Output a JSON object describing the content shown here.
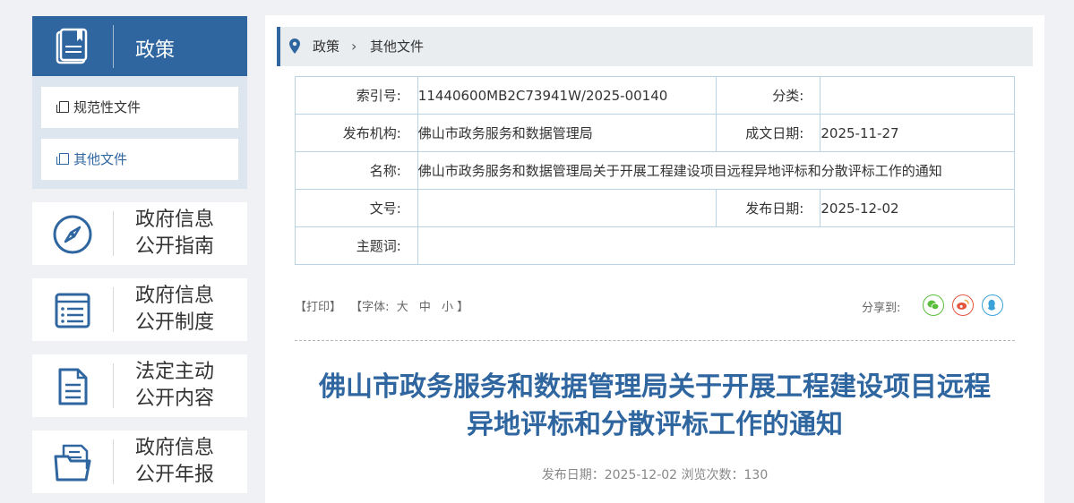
{
  "sidebar": {
    "policy_title": "政策",
    "sub_items": [
      {
        "label": "规范性文件"
      },
      {
        "label": "其他文件"
      }
    ],
    "cards": [
      {
        "line1": "政府信息",
        "line2": "公开指南",
        "icon": "compass-icon"
      },
      {
        "line1": "政府信息",
        "line2": "公开制度",
        "icon": "list-icon"
      },
      {
        "line1": "法定主动",
        "line2": "公开内容",
        "icon": "document-icon"
      },
      {
        "line1": "政府信息",
        "line2": "公开年报",
        "icon": "folder-icon"
      }
    ]
  },
  "breadcrumb": {
    "items": [
      "政策",
      "其他文件"
    ],
    "separator": "›"
  },
  "meta": {
    "index_label": "索引号:",
    "index_value": "11440600MB2C73941W/2025-00140",
    "category_label": "分类:",
    "category_value": "",
    "publisher_label": "发布机构:",
    "publisher_value": "佛山市政务服务和数据管理局",
    "written_date_label": "成文日期:",
    "written_date_value": "2025-11-27",
    "name_label": "名称:",
    "name_value": "佛山市政务服务和数据管理局关于开展工程建设项目远程异地评标和分散评标工作的通知",
    "doc_no_label": "文号:",
    "doc_no_value": "",
    "publish_date_label": "发布日期:",
    "publish_date_value": "2025-12-02",
    "keywords_label": "主题词:",
    "keywords_value": ""
  },
  "tools": {
    "print": "【打印】",
    "font_prefix": "【字体:",
    "font_large": "大",
    "font_medium": "中",
    "font_small": "小",
    "font_suffix": "】"
  },
  "share": {
    "label": "分享到:",
    "icons": [
      "wechat-icon",
      "weibo-icon",
      "qq-icon"
    ]
  },
  "article": {
    "title_line1": "佛山市政务服务和数据管理局关于开展工程建设项目远程",
    "title_line2": "异地评标和分散评标工作的通知",
    "publish_info": "发布日期：2025-12-02  浏览次数：130"
  },
  "colors": {
    "accent": "#2f66a0",
    "wechat": "#5bbd3c",
    "weibo": "#e5553c",
    "qq": "#3aa2d8"
  }
}
